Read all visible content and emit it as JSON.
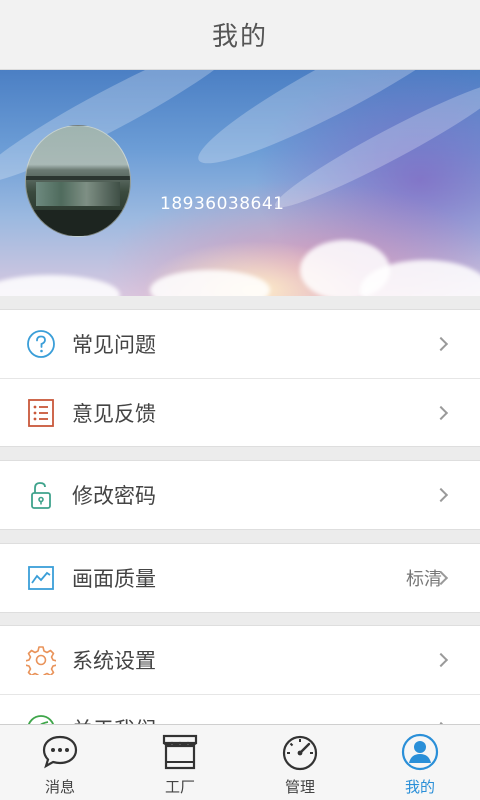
{
  "header": {
    "title": "我的"
  },
  "profile": {
    "phone": "18936038641"
  },
  "menu": {
    "faq": "常见问题",
    "feedback": "意见反馈",
    "change_password": "修改密码",
    "video_quality": "画面质量",
    "video_quality_value": "标清",
    "settings": "系统设置",
    "about": "关于我们"
  },
  "tabbar": {
    "messages": "消息",
    "factory": "工厂",
    "manage": "管理",
    "mine": "我的"
  },
  "colors": {
    "accent": "#2a8fd8",
    "faq_icon": "#3a9ed8",
    "feedback_icon": "#c9583a",
    "password_icon": "#3fa38c",
    "quality_icon": "#3a9ed8",
    "settings_icon": "#e9935a",
    "about_icon": "#3fa64a"
  },
  "icons": {
    "faq": "question-circle-icon",
    "feedback": "list-document-icon",
    "change_password": "unlock-icon",
    "video_quality": "line-chart-icon",
    "settings": "gear-icon",
    "about": "leaf-icon",
    "messages": "chat-bubble-icon",
    "factory": "shop-icon",
    "manage": "speedometer-icon",
    "mine": "user-icon"
  }
}
